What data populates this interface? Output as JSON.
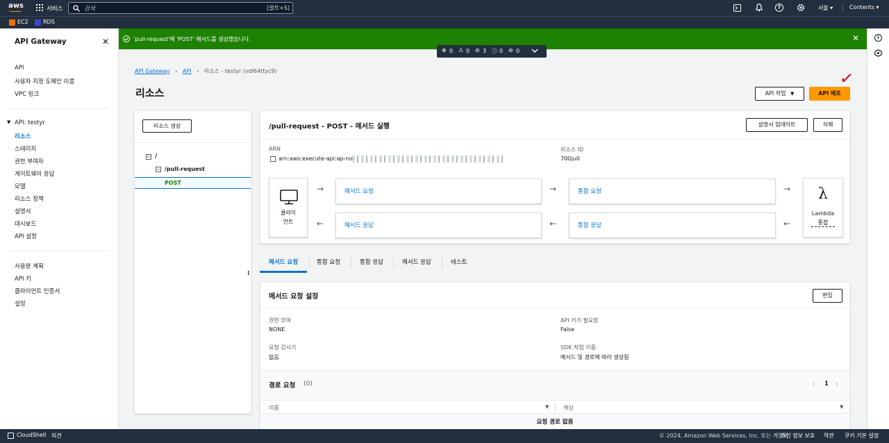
{
  "topbar": {
    "logo": "aws",
    "services_label": "서비스",
    "search_placeholder": "검색",
    "search_shortcut": "[알트+S]",
    "region": "서울 ▾",
    "account": "Contents ▾"
  },
  "favorites": [
    {
      "label": "EC2",
      "color": "#ed7100"
    },
    {
      "label": "RDS",
      "color": "#3b48cc"
    }
  ],
  "sidebar": {
    "title": "API Gateway",
    "top_items": [
      "API",
      "사용자 지정 도메인 이름",
      "VPC 링크"
    ],
    "api_section": "API: testyr",
    "api_items": [
      "리소스",
      "스테이지",
      "권한 부여자",
      "게이트웨이 응답",
      "모델",
      "리소스 정책",
      "설명서",
      "대시보드",
      "API 설정"
    ],
    "active_item": "리소스",
    "bottom_items": [
      "사용량 계획",
      "API 키",
      "클라이언트 인증서",
      "설정"
    ]
  },
  "flash": {
    "message": "'pull-request'에 'POST' 메서드를 생성했습니다.",
    "color": "#1d8102"
  },
  "notifications": [
    {
      "icon": "error-icon",
      "count": "0"
    },
    {
      "icon": "warning-icon",
      "count": "0"
    },
    {
      "icon": "success-icon",
      "count": "3"
    },
    {
      "icon": "info-icon",
      "count": "0"
    },
    {
      "icon": "in-progress-icon",
      "count": "0"
    }
  ],
  "breadcrumb": {
    "items": [
      "API Gateway",
      "API"
    ],
    "current": "리소스 - testyr (vdl64ttyc9)"
  },
  "page": {
    "title": "리소스",
    "api_actions_label": "API 작업",
    "deploy_label": "API 배포",
    "accent_color": "#ff9900"
  },
  "resource_tree": {
    "create_label": "리소스 생성",
    "root": "/",
    "child": "/pull-request",
    "method": "POST"
  },
  "method_panel": {
    "title": "/pull-request - POST - 메서드 실행",
    "update_docs_label": "설명서 업데이트",
    "delete_label": "삭제",
    "arn_label": "ARN",
    "arn_value": "arn:aws:execute-api:ap-nor",
    "resource_id_label": "리소스 ID",
    "resource_id_value": "700ju0",
    "client_label_1": "클라이",
    "client_label_2": "언트",
    "method_request": "메서드 요청",
    "integration_request": "통합 요청",
    "method_response": "메서드 응답",
    "integration_response": "통합 응답",
    "lambda_label": "Lambda",
    "lambda_sub": "통합"
  },
  "tabs": [
    "메서드 요청",
    "통합 요청",
    "통합 응답",
    "메서드 응답",
    "테스트"
  ],
  "active_tab": "메서드 요청",
  "settings": {
    "title": "메서드 요청 설정",
    "edit_label": "편집",
    "auth_label": "권한 부여",
    "auth_value": "NONE",
    "api_key_label": "API 키가 필요함",
    "api_key_value": "False",
    "validator_label": "요청 검사기",
    "validator_value": "없음",
    "sdk_label": "SDK 작업 이름",
    "sdk_value": "메서드 및 경로에 따라 생성됨"
  },
  "path_requests": {
    "title": "경로 요청",
    "count": "(0)",
    "page": "1",
    "col_name": "이름",
    "col_cache": "캐싱",
    "empty": "요청 경로 없음"
  },
  "footer": {
    "cloudshell": "CloudShell",
    "feedback": "의견",
    "copyright": "© 2024, Amazon Web Services, Inc. 또는 계열사.",
    "privacy": "개인 정보 보호",
    "terms": "약관",
    "cookies": "쿠키 기본 설정"
  },
  "annotation": {
    "checkmark": "✓",
    "color": "#e0001b"
  }
}
